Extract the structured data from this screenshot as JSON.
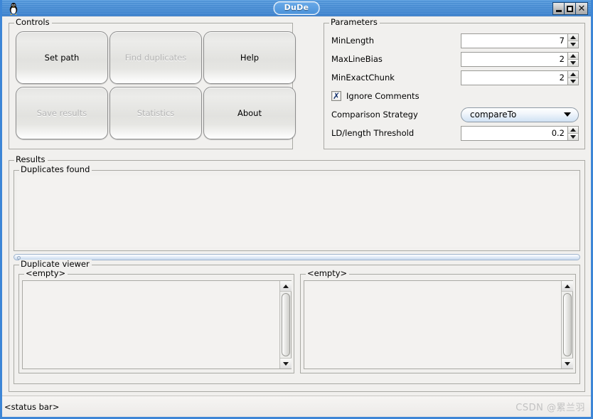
{
  "window": {
    "title": "DuDe",
    "app_icon": "tux-penguin-icon",
    "buttons": {
      "minimize": "_",
      "maximize": "□",
      "close": "✕"
    }
  },
  "controls": {
    "group_title": "Controls",
    "buttons": [
      {
        "label": "Set path",
        "enabled": true
      },
      {
        "label": "Find duplicates",
        "enabled": false
      },
      {
        "label": "Help",
        "enabled": true
      },
      {
        "label": "Save results",
        "enabled": false
      },
      {
        "label": "Statistics",
        "enabled": false
      },
      {
        "label": "About",
        "enabled": true
      }
    ]
  },
  "parameters": {
    "group_title": "Parameters",
    "min_length": {
      "label": "MinLength",
      "value": "7"
    },
    "max_line_bias": {
      "label": "MaxLineBias",
      "value": "2"
    },
    "min_exact_chunk": {
      "label": "MinExactChunk",
      "value": "2"
    },
    "ignore_comments": {
      "label": "Ignore Comments",
      "checked": true,
      "mark": "✗"
    },
    "comparison_strategy": {
      "label": "Comparison Strategy",
      "value": "compareTo"
    },
    "ld_length_threshold": {
      "label": "LD/length Threshold",
      "value": "0.2"
    }
  },
  "results": {
    "group_title": "Results",
    "duplicates_found": {
      "group_title": "Duplicates found",
      "content": ""
    },
    "duplicate_viewer": {
      "group_title": "Duplicate viewer",
      "left_panel": {
        "group_title": "<empty>",
        "content": ""
      },
      "right_panel": {
        "group_title": "<empty>",
        "content": ""
      }
    }
  },
  "statusbar": {
    "text": "<status bar>",
    "watermark": "CSDN @累兰羽"
  },
  "colors": {
    "titlebar": "#4a90d8",
    "window_border": "#3d86d6",
    "panel_bg": "#f1f0ee",
    "disabled_text": "#b4b4b4",
    "checkmark": "#12306b"
  }
}
